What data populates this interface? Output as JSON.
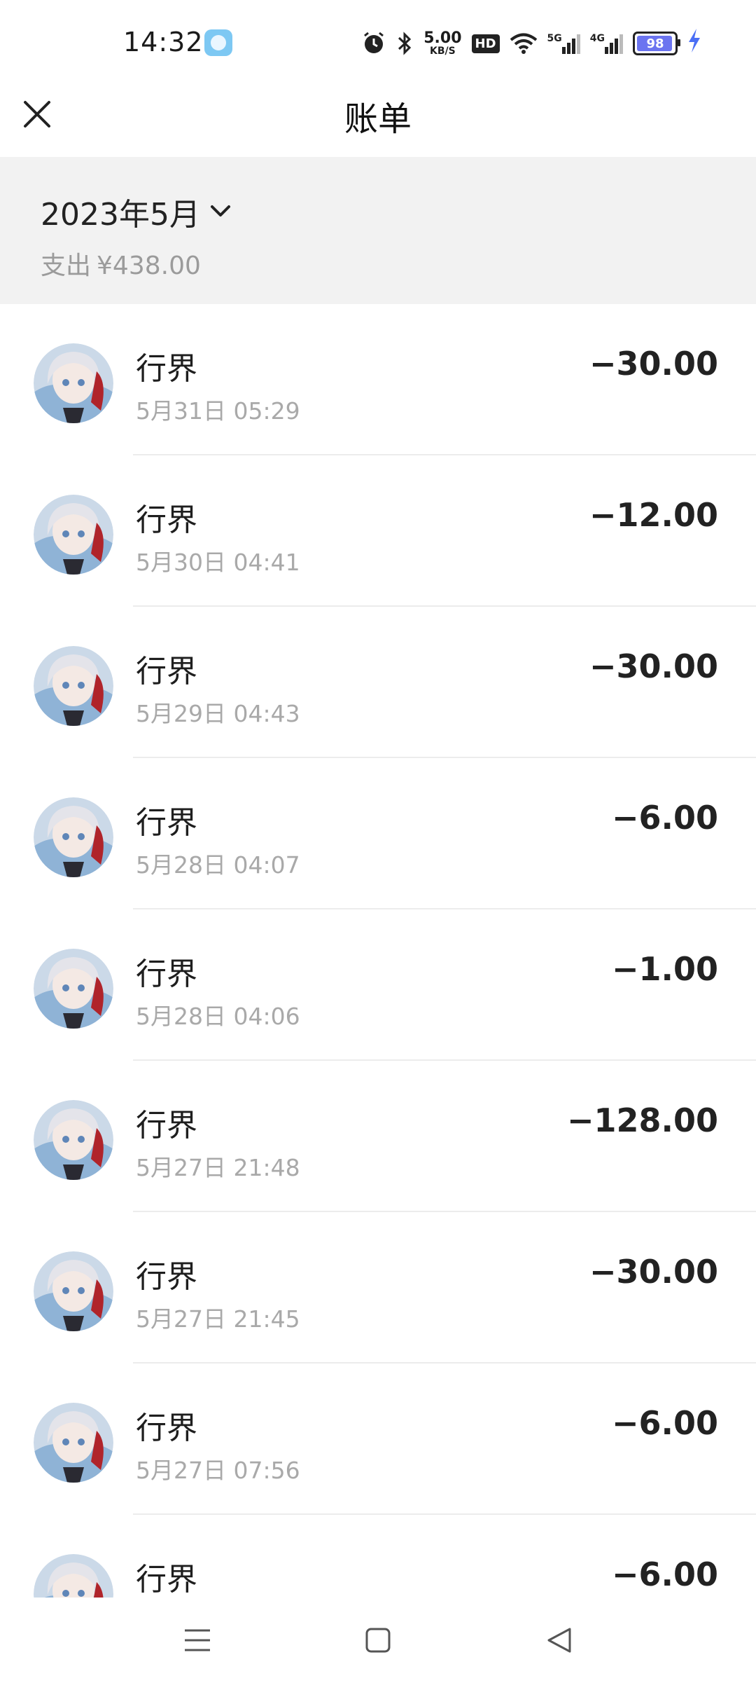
{
  "status_bar": {
    "time": "14:32",
    "net_speed_value": "5.00",
    "net_speed_unit": "KB/S",
    "hd_label": "HD",
    "signal_5g_label": "5G",
    "signal_4g_label": "4G",
    "battery_level": "98",
    "icons": [
      "app-icon",
      "alarm-icon",
      "bluetooth-icon",
      "wifi-icon",
      "signal-5g-icon",
      "signal-4g-icon",
      "battery-icon",
      "charging-icon"
    ]
  },
  "header": {
    "title": "账单",
    "close_icon": "close-icon"
  },
  "summary": {
    "month": "2023年5月",
    "expense_label": "支出",
    "expense_amount": "¥438.00",
    "dropdown_icon": "chevron-down-icon"
  },
  "transactions": [
    {
      "name": "行界",
      "time": "5月31日 05:29",
      "amount": "−30.00"
    },
    {
      "name": "行界",
      "time": "5月30日 04:41",
      "amount": "−12.00"
    },
    {
      "name": "行界",
      "time": "5月29日 04:43",
      "amount": "−30.00"
    },
    {
      "name": "行界",
      "time": "5月28日 04:07",
      "amount": "−6.00"
    },
    {
      "name": "行界",
      "time": "5月28日 04:06",
      "amount": "−1.00"
    },
    {
      "name": "行界",
      "time": "5月27日 21:48",
      "amount": "−128.00"
    },
    {
      "name": "行界",
      "time": "5月27日 21:45",
      "amount": "−30.00"
    },
    {
      "name": "行界",
      "time": "5月27日 07:56",
      "amount": "−6.00"
    },
    {
      "name": "行界",
      "time": "",
      "amount": "−6.00"
    }
  ],
  "nav_bar": {
    "icons": [
      "menu-icon",
      "home-icon",
      "back-icon"
    ]
  },
  "colors": {
    "panel_bg": "#f2f2f2",
    "secondary_text": "#a9a9a9",
    "battery_fill": "#6b74f0",
    "charging": "#4b6ff5"
  }
}
